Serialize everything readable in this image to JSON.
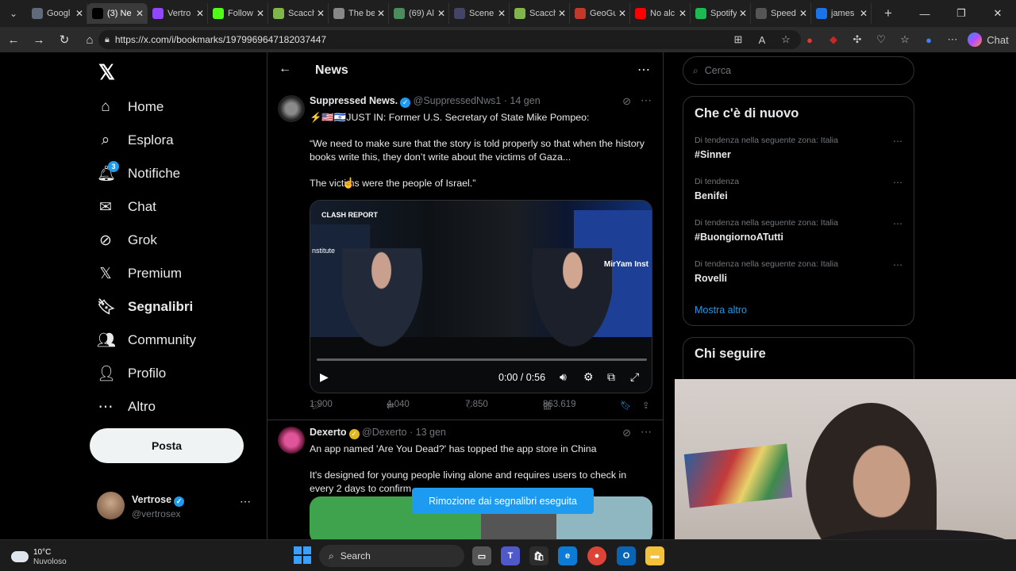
{
  "browser": {
    "tabs": [
      {
        "label": "Googl",
        "icon": "tab-icon",
        "color": "#5f6b7a",
        "active": false
      },
      {
        "label": "(3) Ne",
        "icon": "x-icon",
        "color": "#000000",
        "active": true
      },
      {
        "label": "Vertro",
        "icon": "twitch-icon",
        "color": "#9146ff",
        "active": false
      },
      {
        "label": "Follow",
        "icon": "kick-icon",
        "color": "#53fc18",
        "active": false
      },
      {
        "label": "Scacch",
        "icon": "chess-icon",
        "color": "#81b64c",
        "active": false
      },
      {
        "label": "The be",
        "icon": "chess-icon",
        "color": "#888888",
        "active": false
      },
      {
        "label": "(69) Al",
        "icon": "tab-icon",
        "color": "#4c8b5a",
        "active": false
      },
      {
        "label": "Scene",
        "icon": "tab-icon",
        "color": "#444466",
        "active": false
      },
      {
        "label": "Scacch",
        "icon": "chess-icon",
        "color": "#81b64c",
        "active": false
      },
      {
        "label": "GeoGu",
        "icon": "map-pin-icon",
        "color": "#c0392b",
        "active": false
      },
      {
        "label": "No alc",
        "icon": "youtube-icon",
        "color": "#ff0000",
        "active": false
      },
      {
        "label": "Spotify",
        "icon": "spotify-icon",
        "color": "#1db954",
        "active": false
      },
      {
        "label": "Speed",
        "icon": "speed-icon",
        "color": "#555555",
        "active": false
      },
      {
        "label": "james",
        "icon": "search-icon",
        "color": "#1a73e8",
        "active": false
      }
    ],
    "url": "https://x.com/i/bookmarks/1979969647182037447",
    "copilot_label": "Chat"
  },
  "nav": {
    "items": [
      {
        "label": "Home",
        "icon": "home-icon",
        "glyph": "⌂"
      },
      {
        "label": "Esplora",
        "icon": "search-icon",
        "glyph": "⌕"
      },
      {
        "label": "Notifiche",
        "icon": "bell-icon",
        "glyph": "🔔︎",
        "badge": "3"
      },
      {
        "label": "Chat",
        "icon": "mail-icon",
        "glyph": "✉"
      },
      {
        "label": "Grok",
        "icon": "grok-icon",
        "glyph": "⊘"
      },
      {
        "label": "Premium",
        "icon": "x-premium-icon",
        "glyph": "𝕏"
      },
      {
        "label": "Segnalibri",
        "icon": "bookmark-icon",
        "glyph": "🔖︎"
      },
      {
        "label": "Community",
        "icon": "community-icon",
        "glyph": "👥︎"
      },
      {
        "label": "Profilo",
        "icon": "profile-icon",
        "glyph": "👤︎"
      },
      {
        "label": "Altro",
        "icon": "more-circle-icon",
        "glyph": "⋯"
      }
    ],
    "post_label": "Posta",
    "account": {
      "name": "Vertrose",
      "handle": "@vertrosex"
    }
  },
  "feed": {
    "title": "News",
    "tweets": [
      {
        "name": "Suppressed News.",
        "handle": "@SuppressedNws1",
        "time": "· 14 gen",
        "text_lines": [
          "⚡🇺🇸🇮🇱JUST IN: Former U.S. Secretary of State Mike Pompeo:",
          "“We need to make sure that the story is told properly so that when the history books write this, they don’t write about the victims of Gaza...",
          "The victims were the people of Israel.”"
        ],
        "video": {
          "time": "0:00 / 0:56",
          "watermark": "CLASH REPORT",
          "brand_right": "MirYam Inst",
          "brand_left": "nstitute"
        },
        "stats": {
          "replies": "1.900",
          "reposts": "4.040",
          "likes": "7.850",
          "views": "863.619"
        }
      },
      {
        "name": "Dexerto",
        "handle": "@Dexerto",
        "time": "· 13 gen",
        "text_lines": [
          "An app named 'Are You Dead?' has topped the app store in China",
          "It's designed for young people living alone and requires users to check in every 2 days to confirm"
        ]
      }
    ],
    "toast": "Rimozione dai segnalibri eseguita"
  },
  "sidebar": {
    "search_placeholder": "Cerca",
    "trends_title": "Che c'è di nuovo",
    "trends": [
      {
        "context": "Di tendenza nella seguente zona: Italia",
        "name": "#Sinner"
      },
      {
        "context": "Di tendenza",
        "name": "Benifei"
      },
      {
        "context": "Di tendenza nella seguente zona: Italia",
        "name": "#BuongiornoATutti"
      },
      {
        "context": "Di tendenza nella seguente zona: Italia",
        "name": "Rovelli"
      }
    ],
    "show_more": "Mostra altro",
    "follow_title": "Chi seguire"
  },
  "taskbar": {
    "temperature": "10°C",
    "weather": "Nuvoloso",
    "search_label": "Search"
  },
  "colors": {
    "accent": "#1d9bf0",
    "background": "#000000",
    "border": "#2f3336"
  }
}
